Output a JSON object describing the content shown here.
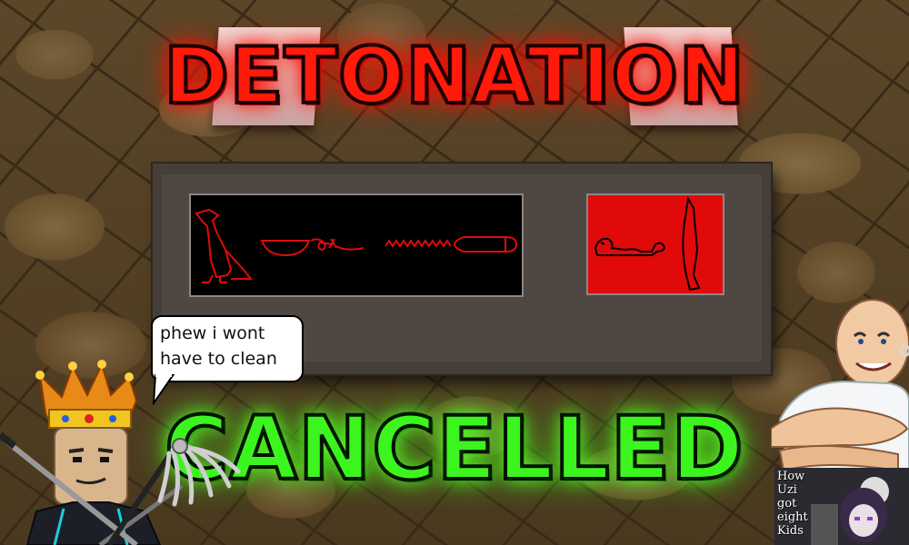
{
  "title_top": "DETONATION",
  "title_bottom": "CANCELLED",
  "speech_bubble": "phew i wont have to clean",
  "bottom_caption": "",
  "thumbnail": {
    "text": "How\nUzi\ngot\neight\nKids"
  },
  "colors": {
    "title_top": "#ff1a0a",
    "title_bottom": "#3df51e",
    "panel_glyph": "#e00a0a",
    "panel_right_bg": "#e00a0a"
  },
  "icons": {
    "left_panel": [
      "vulture-glyph",
      "basket-glyph",
      "cord-glyph",
      "water-glyph",
      "vessel-glyph"
    ],
    "right_panel": [
      "lion-glyph",
      "knife-glyph"
    ]
  }
}
